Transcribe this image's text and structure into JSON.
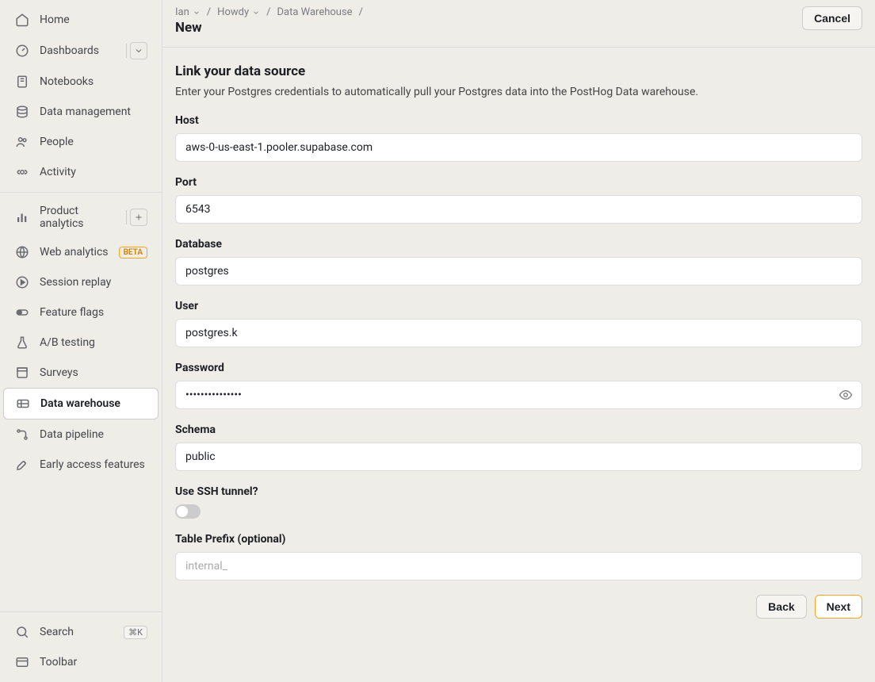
{
  "sidebar": {
    "top": [
      {
        "icon": "home",
        "label": "Home"
      },
      {
        "icon": "dashboard",
        "label": "Dashboards",
        "hasChevron": true
      },
      {
        "icon": "notebook",
        "label": "Notebooks"
      },
      {
        "icon": "database",
        "label": "Data management"
      },
      {
        "icon": "people",
        "label": "People"
      },
      {
        "icon": "activity",
        "label": "Activity"
      }
    ],
    "middle": [
      {
        "icon": "analytics",
        "label": "Product analytics",
        "hasPlus": true
      },
      {
        "icon": "web",
        "label": "Web analytics",
        "badge": "BETA"
      },
      {
        "icon": "replay",
        "label": "Session replay"
      },
      {
        "icon": "flag",
        "label": "Feature flags"
      },
      {
        "icon": "flask",
        "label": "A/B testing"
      },
      {
        "icon": "survey",
        "label": "Surveys"
      },
      {
        "icon": "warehouse",
        "label": "Data warehouse",
        "active": true
      },
      {
        "icon": "pipeline",
        "label": "Data pipeline"
      },
      {
        "icon": "rocket",
        "label": "Early access features"
      }
    ],
    "bottom": [
      {
        "icon": "search",
        "label": "Search",
        "kbd": "⌘K"
      },
      {
        "icon": "toolbar",
        "label": "Toolbar"
      }
    ]
  },
  "breadcrumb": {
    "items": [
      "Ian",
      "Howdy",
      "Data Warehouse"
    ],
    "title": "New"
  },
  "header": {
    "cancel": "Cancel"
  },
  "form": {
    "title": "Link your data source",
    "description": "Enter your Postgres credentials to automatically pull your Postgres data into the PostHog Data warehouse.",
    "fields": {
      "host": {
        "label": "Host",
        "value": "aws-0-us-east-1.pooler.supabase.com"
      },
      "port": {
        "label": "Port",
        "value": "6543"
      },
      "database": {
        "label": "Database",
        "value": "postgres"
      },
      "user": {
        "label": "User",
        "value": "postgres.k"
      },
      "password": {
        "label": "Password",
        "value": "•••••••••••••••"
      },
      "schema": {
        "label": "Schema",
        "value": "public"
      },
      "ssh": {
        "label": "Use SSH tunnel?",
        "value": false
      },
      "prefix": {
        "label": "Table Prefix (optional)",
        "placeholder": "internal_",
        "value": ""
      }
    },
    "back": "Back",
    "next": "Next"
  }
}
